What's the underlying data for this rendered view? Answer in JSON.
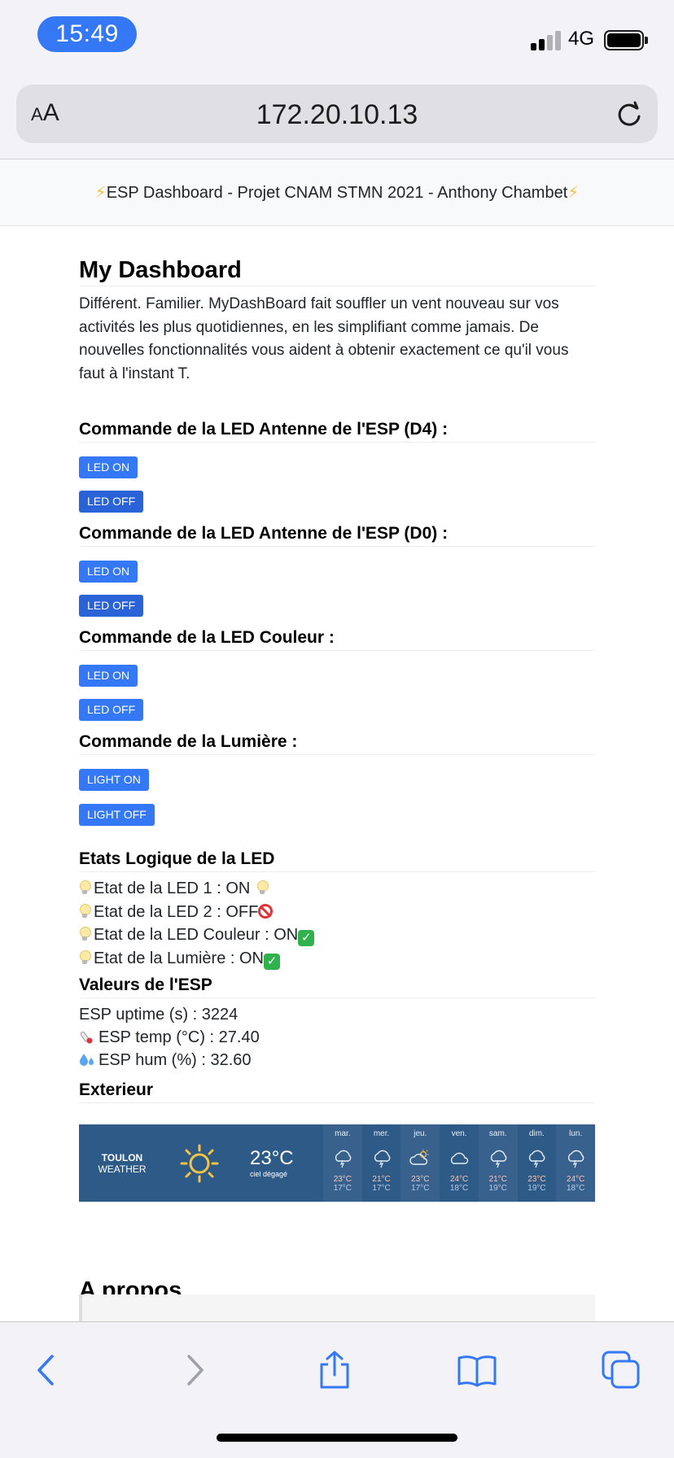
{
  "status_bar": {
    "time": "15:49",
    "network": "4G",
    "signal_bars": 2,
    "battery_level": 0.9
  },
  "browser": {
    "aa_small": "A",
    "aa_big": "A",
    "url": "172.20.10.13"
  },
  "header": {
    "bolt_left": "⚡",
    "title": "ESP Dashboard - Projet CNAM STMN 2021 - Anthony Chambet",
    "bolt_right": "⚡"
  },
  "main": {
    "title": "My Dashboard",
    "intro": "Différent. Familier. MyDashBoard fait souffler un vent nouveau sur vos activités les plus quotidiennes, en les simplifiant comme jamais. De nouvelles fonctionnalités vous aident à obtenir exactement ce qu'il vous faut à l'instant T.",
    "sections": [
      {
        "title": "Commande de la LED Antenne de l'ESP (D4) :",
        "on": "LED ON",
        "off": "LED OFF"
      },
      {
        "title": "Commande de la LED Antenne de l'ESP (D0) :",
        "on": "LED ON",
        "off": "LED OFF"
      },
      {
        "title": "Commande de la LED Couleur :",
        "on": "LED ON",
        "off": "LED OFF"
      },
      {
        "title": "Commande de la Lumière :",
        "on": "LIGHT ON",
        "off": "LIGHT OFF"
      }
    ],
    "states": {
      "title": "Etats Logique de la LED",
      "items": [
        {
          "text": "Etat de la LED 1 : ON "
        },
        {
          "text": "Etat de la LED 2 : OFF"
        },
        {
          "text": "Etat de la LED Couleur : ON"
        },
        {
          "text": "Etat de la Lumière : ON"
        }
      ]
    },
    "esp": {
      "title": "Valeurs de l'ESP",
      "uptime": "ESP uptime (s) : 3224",
      "temp": "ESP temp (°C) : 27.40",
      "hum": "ESP hum (%) : 32.60"
    },
    "exterior": {
      "title": "Exterieur",
      "weather": {
        "city": "TOULON",
        "label": "WEATHER",
        "temp": "23°C",
        "desc": "ciel dégagé",
        "days": [
          {
            "name": "mar.",
            "icon": "rain-cloud-icon",
            "hi": "23°C",
            "lo": "17°C"
          },
          {
            "name": "mer.",
            "icon": "rain-cloud-icon",
            "hi": "21°C",
            "lo": "17°C"
          },
          {
            "name": "jeu.",
            "icon": "sun-cloud-icon",
            "hi": "23°C",
            "lo": "17°C"
          },
          {
            "name": "ven.",
            "icon": "cloud-icon",
            "hi": "24°C",
            "lo": "18°C"
          },
          {
            "name": "sam.",
            "icon": "rain-cloud-icon",
            "hi": "21°C",
            "lo": "19°C"
          },
          {
            "name": "dim.",
            "icon": "rain-cloud-icon",
            "hi": "23°C",
            "lo": "19°C"
          },
          {
            "name": "lun.",
            "icon": "rain-cloud-icon",
            "hi": "24°C",
            "lo": "18°C"
          }
        ]
      }
    },
    "about": {
      "title": "A propos"
    }
  },
  "colors": {
    "accent": "#3478f6",
    "weather_bg": "#2e5a87",
    "check": "#2fb24c",
    "forbid": "#e0343a"
  }
}
